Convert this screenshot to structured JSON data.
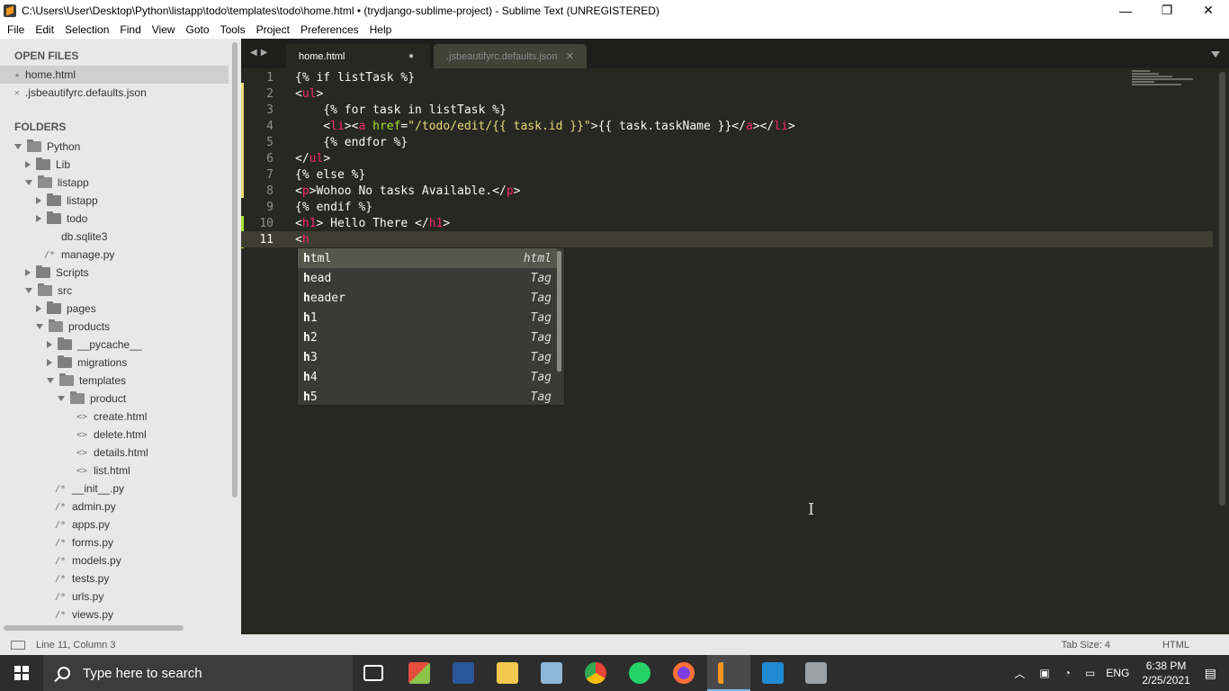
{
  "window": {
    "title": "C:\\Users\\User\\Desktop\\Python\\listapp\\todo\\templates\\todo\\home.html • (trydjango-sublime-project) - Sublime Text (UNREGISTERED)",
    "controls": [
      "—",
      "❐",
      "✕"
    ]
  },
  "menu": [
    "File",
    "Edit",
    "Selection",
    "Find",
    "View",
    "Goto",
    "Tools",
    "Project",
    "Preferences",
    "Help"
  ],
  "sidebar": {
    "open_files_label": "OPEN FILES",
    "open_files": [
      "home.html",
      ".jsbeautifyrc.defaults.json"
    ],
    "folders_label": "FOLDERS",
    "tree": [
      {
        "label": "Python",
        "kind": "folder-open"
      },
      {
        "label": "Lib",
        "kind": "folder"
      },
      {
        "label": "listapp",
        "kind": "folder-open"
      },
      {
        "label": "listapp",
        "kind": "folder"
      },
      {
        "label": "todo",
        "kind": "folder"
      },
      {
        "label": "db.sqlite3",
        "kind": "file"
      },
      {
        "label": "manage.py",
        "kind": "py"
      },
      {
        "label": "Scripts",
        "kind": "folder"
      },
      {
        "label": "src",
        "kind": "folder-open"
      },
      {
        "label": "pages",
        "kind": "folder"
      },
      {
        "label": "products",
        "kind": "folder-open"
      },
      {
        "label": "__pycache__",
        "kind": "folder"
      },
      {
        "label": "migrations",
        "kind": "folder"
      },
      {
        "label": "templates",
        "kind": "folder-open"
      },
      {
        "label": "product",
        "kind": "folder-open"
      },
      {
        "label": "create.html",
        "kind": "html"
      },
      {
        "label": "delete.html",
        "kind": "html"
      },
      {
        "label": "details.html",
        "kind": "html"
      },
      {
        "label": "list.html",
        "kind": "html"
      },
      {
        "label": "__init__.py",
        "kind": "py"
      },
      {
        "label": "admin.py",
        "kind": "py"
      },
      {
        "label": "apps.py",
        "kind": "py"
      },
      {
        "label": "forms.py",
        "kind": "py"
      },
      {
        "label": "models.py",
        "kind": "py"
      },
      {
        "label": "tests.py",
        "kind": "py"
      },
      {
        "label": "urls.py",
        "kind": "py"
      },
      {
        "label": "views.py",
        "kind": "py"
      }
    ]
  },
  "tabs": [
    {
      "label": "home.html",
      "modified_marker": "●"
    },
    {
      "label": ".jsbeautifyrc.defaults.json",
      "close": "✕"
    }
  ],
  "editor": {
    "line_numbers": [
      "1",
      "2",
      "3",
      "4",
      "5",
      "6",
      "7",
      "8",
      "9",
      "10",
      "11"
    ],
    "current_line": 11,
    "autocomplete": [
      {
        "prefix": "h",
        "rest": "tml",
        "kind": "html"
      },
      {
        "prefix": "h",
        "rest": "ead",
        "kind": "Tag"
      },
      {
        "prefix": "h",
        "rest": "eader",
        "kind": "Tag"
      },
      {
        "prefix": "h",
        "rest": "1",
        "kind": "Tag"
      },
      {
        "prefix": "h",
        "rest": "2",
        "kind": "Tag"
      },
      {
        "prefix": "h",
        "rest": "3",
        "kind": "Tag"
      },
      {
        "prefix": "h",
        "rest": "4",
        "kind": "Tag"
      },
      {
        "prefix": "h",
        "rest": "5",
        "kind": "Tag"
      }
    ]
  },
  "status": {
    "position": "Line 11, Column 3",
    "tab_size": "Tab Size: 4",
    "syntax": "HTML"
  },
  "taskbar": {
    "search_placeholder": "Type here to search",
    "language": "ENG",
    "time": "6:38 PM",
    "date": "2/25/2021"
  },
  "colors": {
    "editor_bg": "#272822",
    "tag": "#f92672",
    "attr": "#a6e22e",
    "string": "#e6db74",
    "sidebar_bg": "#e8e8e8"
  }
}
